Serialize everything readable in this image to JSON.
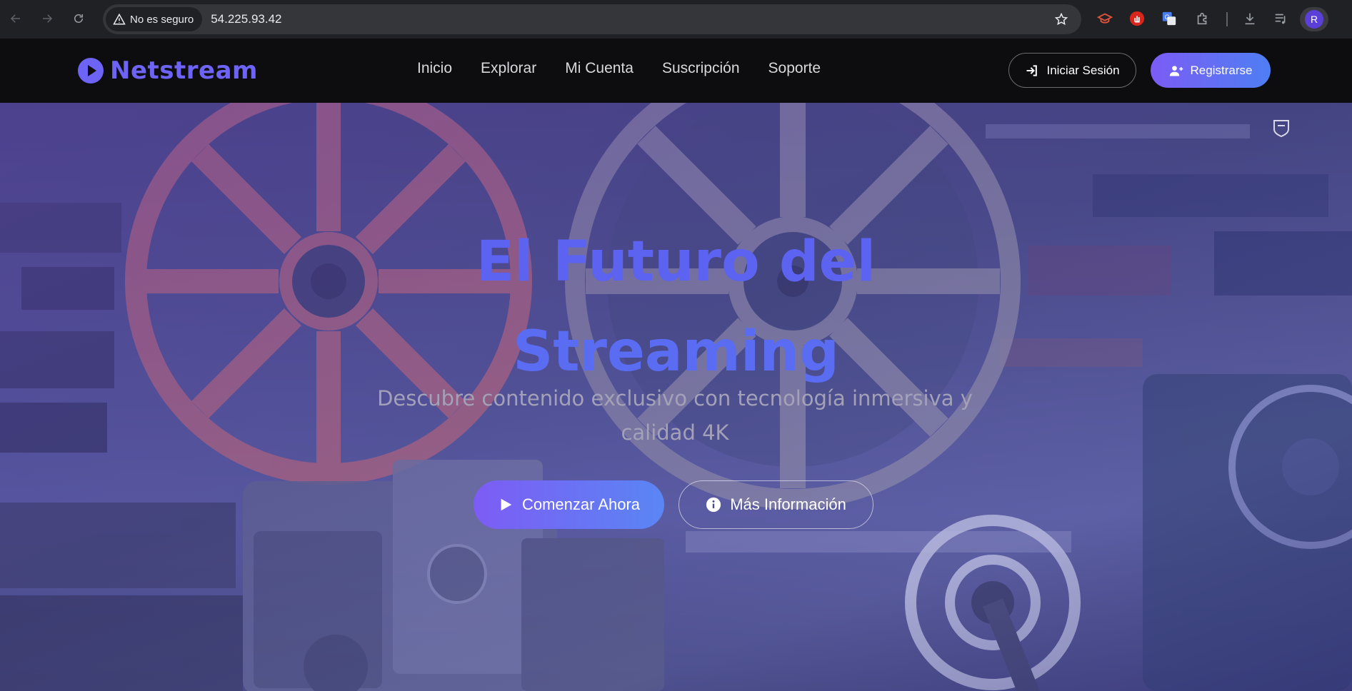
{
  "browser": {
    "security_label": "No es seguro",
    "url": "54.225.93.42",
    "profile_initial": "R"
  },
  "site": {
    "brand": "Netstream",
    "nav": [
      "Inicio",
      "Explorar",
      "Mi Cuenta",
      "Suscripción",
      "Soporte"
    ],
    "login_label": "Iniciar Sesión",
    "register_label": "Registrarse"
  },
  "hero": {
    "title_line1": "El Futuro del",
    "title_line2": "Streaming",
    "subtitle_line1": "Descubre contenido exclusivo con tecnología inmersiva y",
    "subtitle_line2": "calidad 4K",
    "primary_cta": "Comenzar Ahora",
    "secondary_cta": "Más Información"
  },
  "colors": {
    "brand": "#6d63f5",
    "gradient_start": "#7b5cf5",
    "gradient_end": "#4f7ef3"
  }
}
